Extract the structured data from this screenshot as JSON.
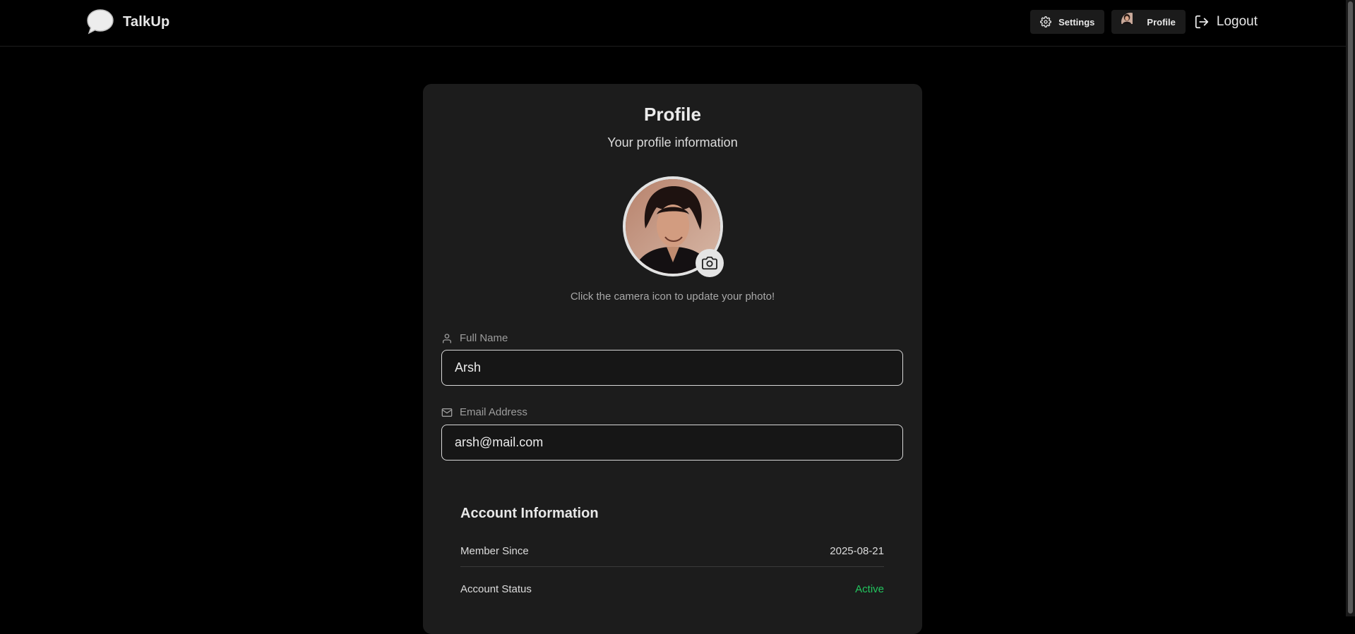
{
  "app": {
    "name": "TalkUp"
  },
  "nav": {
    "settings_label": "Settings",
    "profile_label": "Profile",
    "logout_label": "Logout"
  },
  "profile": {
    "title": "Profile",
    "subtitle": "Your profile information",
    "photo_hint": "Click the camera icon to update your photo!",
    "full_name_label": "Full Name",
    "full_name_value": "Arsh",
    "email_label": "Email Address",
    "email_value": "arsh@mail.com"
  },
  "account": {
    "title": "Account Information",
    "member_since_label": "Member Since",
    "member_since_value": "2025-08-21",
    "status_label": "Account Status",
    "status_value": "Active",
    "status_color": "#22c55e"
  },
  "icons": {
    "logo": "chat-bubble-icon",
    "settings": "gear-icon",
    "logout": "logout-icon",
    "camera": "camera-icon",
    "user": "user-icon",
    "mail": "mail-icon"
  }
}
